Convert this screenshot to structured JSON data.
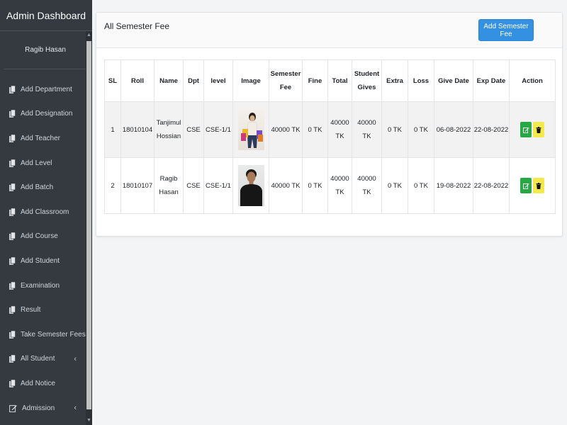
{
  "sidebar": {
    "brand": "Admin Dashboard",
    "user_name": "Ragib Hasan",
    "items": [
      {
        "label": "Add Department",
        "icon": "copy-icon"
      },
      {
        "label": "Add Designation",
        "icon": "copy-icon"
      },
      {
        "label": "Add Teacher",
        "icon": "copy-icon"
      },
      {
        "label": "Add Level",
        "icon": "copy-icon"
      },
      {
        "label": "Add Batch",
        "icon": "copy-icon"
      },
      {
        "label": "Add Classroom",
        "icon": "copy-icon"
      },
      {
        "label": "Add Course",
        "icon": "copy-icon"
      },
      {
        "label": "Add Student",
        "icon": "copy-icon"
      },
      {
        "label": "Examination",
        "icon": "copy-icon"
      },
      {
        "label": "Result",
        "icon": "copy-icon"
      },
      {
        "label": "Take Semester Fees",
        "icon": "copy-icon"
      },
      {
        "label": "All Student",
        "icon": "copy-icon",
        "chevron": "‹"
      },
      {
        "label": "Add Notice",
        "icon": "copy-icon"
      },
      {
        "label": "Admission",
        "icon": "edit-icon",
        "chevron": "‹"
      }
    ]
  },
  "card": {
    "title": "All Semester Fee",
    "add_button": "Add Semester Fee"
  },
  "table": {
    "headers": {
      "sl": "SL",
      "roll": "Roll",
      "name": "Name",
      "dpt": "Dpt",
      "level": "level",
      "image": "Image",
      "semester_fee_1": "Semester",
      "semester_fee_2": "Fee",
      "fine": "Fine",
      "total": "Total",
      "student_gives_1": "Student",
      "student_gives_2": "Gives",
      "extra": "Extra",
      "loss": "Loss",
      "give_date": "Give Date",
      "exp_date": "Exp Date",
      "action": "Action"
    },
    "rows": [
      {
        "sl": "1",
        "roll": "18010104",
        "name_1": "Tanjimul",
        "name_2": "Hossian",
        "dpt": "CSE",
        "level": "CSE-1/1",
        "semester_fee": "40000 TK",
        "fine": "0 TK",
        "total_1": "40000",
        "total_2": "TK",
        "gives_1": "40000",
        "gives_2": "TK",
        "extra": "0 TK",
        "loss": "0 TK",
        "give_date": "06-08-2022",
        "exp_date": "22-08-2022"
      },
      {
        "sl": "2",
        "roll": "18010107",
        "name_1": "Ragib",
        "name_2": "Hasan",
        "dpt": "CSE",
        "level": "CSE-1/1",
        "semester_fee": "40000 TK",
        "fine": "0 TK",
        "total_1": "40000",
        "total_2": "TK",
        "gives_1": "40000",
        "gives_2": "TK",
        "extra": "0 TK",
        "loss": "0 TK",
        "give_date": "19-08-2022",
        "exp_date": "22-08-2022"
      }
    ]
  },
  "colors": {
    "sidebar_bg": "#343a40",
    "primary_button": "#3490e0",
    "edit_button": "#28a745",
    "delete_button": "#f4e94a"
  }
}
